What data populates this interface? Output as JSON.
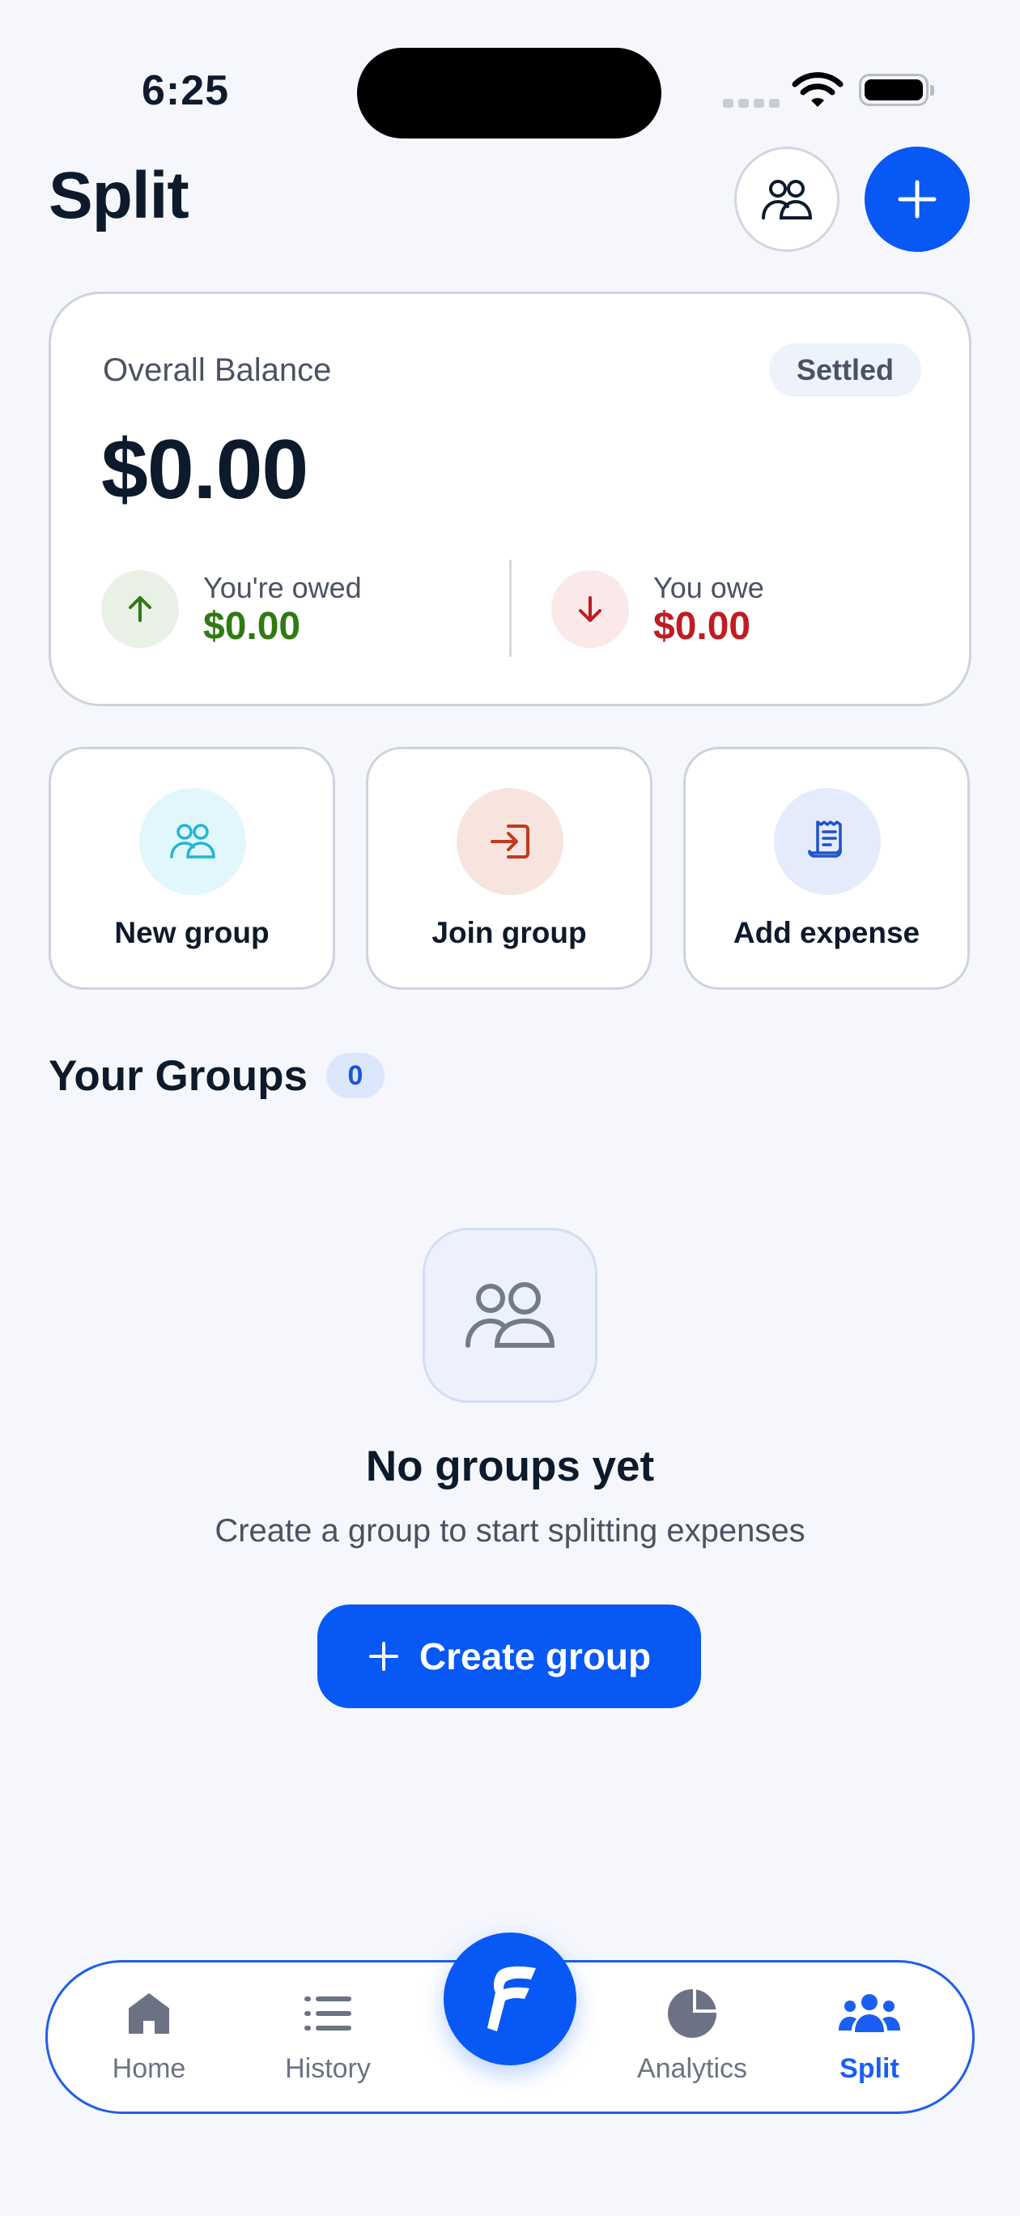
{
  "status_bar": {
    "time": "6:25"
  },
  "header": {
    "title": "Split",
    "people_icon": "people-icon",
    "add_icon": "plus-icon"
  },
  "balance": {
    "label": "Overall Balance",
    "status": "Settled",
    "amount": "$0.00",
    "owed_label": "You're owed",
    "owed_value": "$0.00",
    "owe_label": "You owe",
    "owe_value": "$0.00",
    "colors": {
      "owed": "#2f7a12",
      "owe": "#c01c22"
    }
  },
  "actions": [
    {
      "label": "New group",
      "icon": "users-icon"
    },
    {
      "label": "Join group",
      "icon": "enter-icon"
    },
    {
      "label": "Add expense",
      "icon": "receipt-icon"
    }
  ],
  "groups": {
    "title": "Your Groups",
    "count": "0",
    "empty_title": "No groups yet",
    "empty_subtitle": "Create a group to start splitting expenses",
    "create_label": "Create group"
  },
  "nav": {
    "items": [
      {
        "label": "Home",
        "icon": "home-icon"
      },
      {
        "label": "History",
        "icon": "list-icon"
      },
      {
        "label": "Analytics",
        "icon": "pie-chart-icon"
      },
      {
        "label": "Split",
        "icon": "group-icon"
      }
    ],
    "active": "Split",
    "center_icon": "app-logo-icon"
  },
  "accent_color": "#0758f5"
}
